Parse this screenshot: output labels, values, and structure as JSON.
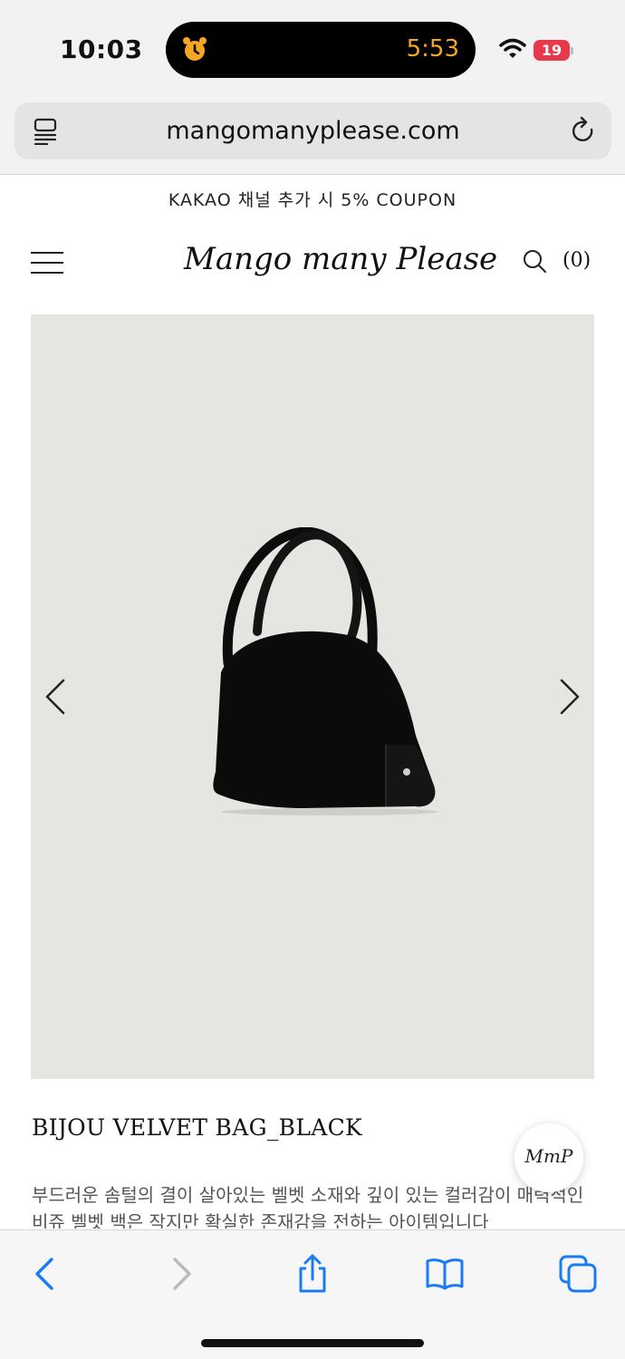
{
  "status_bar": {
    "time": "10:03",
    "timer": "5:53",
    "battery": "19"
  },
  "browser": {
    "url": "mangomanyplease.com"
  },
  "site": {
    "promo_text": "KAKAO 채널 추가 시 5% COUPON",
    "logo_text": "Mango many Please",
    "cart_count": "(0)"
  },
  "product": {
    "title": "BIJOU VELVET BAG_BLACK",
    "description": "부드러운 솜털의 결이 살아있는 벨벳 소재와 깊이 있는 컬러감이 매력적인 비쥬 벨벳 백은 작지만 확실한 존재감을 전하는 아이템입니다"
  },
  "floating_button": {
    "label": "MmP"
  },
  "colors": {
    "accent": "#1a7cf5",
    "battery_low": "#e8394a",
    "timer": "#f5a623",
    "image_bg": "#e6e5e1"
  },
  "icons": [
    "alarm-icon",
    "wifi-icon",
    "reader-icon",
    "reload-icon",
    "menu-icon",
    "search-icon",
    "chevron-left-icon",
    "chevron-right-icon",
    "back-icon",
    "forward-icon",
    "share-icon",
    "bookmarks-icon",
    "tabs-icon"
  ]
}
